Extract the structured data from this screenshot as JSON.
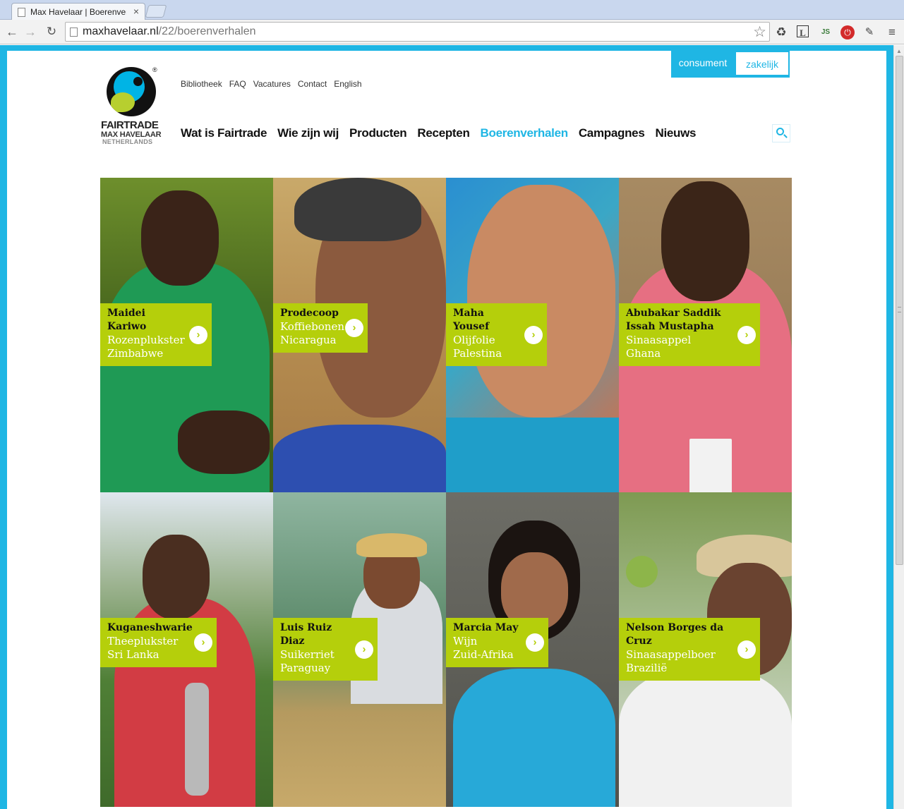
{
  "browser": {
    "tab_title": "Max Havelaar | Boerenverhalen",
    "url_domain": "maxhavelaar.nl",
    "url_path": "/22/boerenverhalen"
  },
  "logo": {
    "line1": "FAIRTRADE",
    "line2": "MAX HAVELAAR",
    "line3": "NETHERLANDS",
    "reg": "®"
  },
  "topnav": [
    "Bibliotheek",
    "FAQ",
    "Vacatures",
    "Contact",
    "English"
  ],
  "mainnav": {
    "items": [
      "Wat is Fairtrade",
      "Wie zijn wij",
      "Producten",
      "Recepten",
      "Boerenverhalen",
      "Campagnes",
      "Nieuws"
    ],
    "active": "Boerenverhalen"
  },
  "switch": {
    "consument": "consument",
    "zakelijk": "zakelijk"
  },
  "colors": {
    "brand_blue": "#1fb6e4",
    "brand_green": "#b5cf0b"
  },
  "farmers": [
    {
      "name": "Maidei Kariwo",
      "role": "Rozenplukster",
      "country": "Zimbabwe"
    },
    {
      "name": "Prodecoop",
      "role": "Koffiebonen",
      "country": "Nicaragua"
    },
    {
      "name": "Maha Yousef",
      "role": "Olijfolie",
      "country": "Palestina"
    },
    {
      "name": "Abubakar Saddik Issah Mustapha",
      "role": "Sinaasappel",
      "country": "Ghana"
    },
    {
      "name": "Kuganeshwarie",
      "role": "Theeplukster",
      "country": "Sri Lanka"
    },
    {
      "name": "Luis Ruiz Diaz",
      "role": "Suikerriet",
      "country": "Paraguay"
    },
    {
      "name": "Marcia May",
      "role": "Wijn",
      "country": "Zuid-Afrika"
    },
    {
      "name": "Nelson Borges da Cruz",
      "role": "Sinaasappelboer",
      "country": "Brazilië"
    }
  ]
}
